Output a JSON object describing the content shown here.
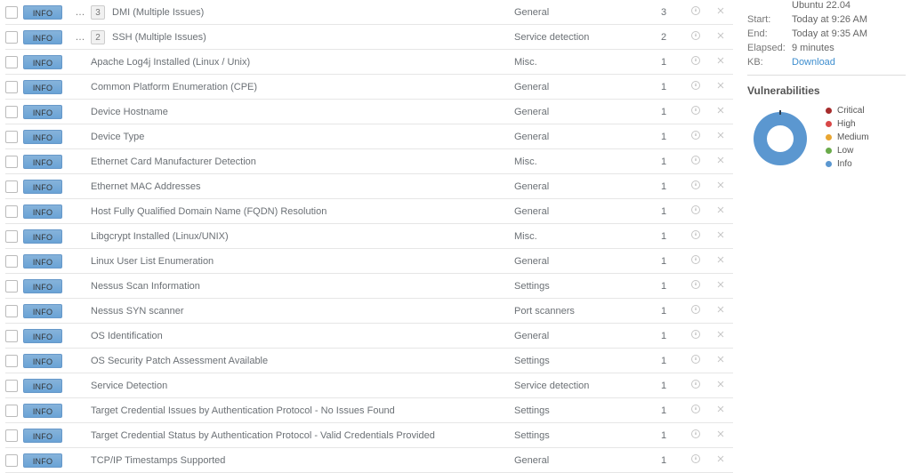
{
  "severity_label": "INFO",
  "rows": [
    {
      "badge": "3",
      "name": "DMI (Multiple Issues)",
      "family": "General",
      "count": "3",
      "multi": true
    },
    {
      "badge": "2",
      "name": "SSH (Multiple Issues)",
      "family": "Service detection",
      "count": "2",
      "multi": true
    },
    {
      "name": "Apache Log4j Installed (Linux / Unix)",
      "family": "Misc.",
      "count": "1"
    },
    {
      "name": "Common Platform Enumeration (CPE)",
      "family": "General",
      "count": "1"
    },
    {
      "name": "Device Hostname",
      "family": "General",
      "count": "1"
    },
    {
      "name": "Device Type",
      "family": "General",
      "count": "1"
    },
    {
      "name": "Ethernet Card Manufacturer Detection",
      "family": "Misc.",
      "count": "1"
    },
    {
      "name": "Ethernet MAC Addresses",
      "family": "General",
      "count": "1"
    },
    {
      "name": "Host Fully Qualified Domain Name (FQDN) Resolution",
      "family": "General",
      "count": "1"
    },
    {
      "name": "Libgcrypt Installed (Linux/UNIX)",
      "family": "Misc.",
      "count": "1"
    },
    {
      "name": "Linux User List Enumeration",
      "family": "General",
      "count": "1"
    },
    {
      "name": "Nessus Scan Information",
      "family": "Settings",
      "count": "1"
    },
    {
      "name": "Nessus SYN scanner",
      "family": "Port scanners",
      "count": "1"
    },
    {
      "name": "OS Identification",
      "family": "General",
      "count": "1"
    },
    {
      "name": "OS Security Patch Assessment Available",
      "family": "Settings",
      "count": "1"
    },
    {
      "name": "Service Detection",
      "family": "Service detection",
      "count": "1"
    },
    {
      "name": "Target Credential Issues by Authentication Protocol - No Issues Found",
      "family": "Settings",
      "count": "1"
    },
    {
      "name": "Target Credential Status by Authentication Protocol - Valid Credentials Provided",
      "family": "Settings",
      "count": "1"
    },
    {
      "name": "TCP/IP Timestamps Supported",
      "family": "General",
      "count": "1"
    }
  ],
  "side": {
    "os": "Ubuntu 22.04",
    "start_label": "Start:",
    "start_value": "Today at 9:26 AM",
    "end_label": "End:",
    "end_value": "Today at 9:35 AM",
    "elapsed_label": "Elapsed:",
    "elapsed_value": "9 minutes",
    "kb_label": "KB:",
    "kb_link": "Download",
    "vuln_title": "Vulnerabilities",
    "legend": [
      {
        "label": "Critical",
        "color": "#a62c2c"
      },
      {
        "label": "High",
        "color": "#d84848"
      },
      {
        "label": "Medium",
        "color": "#e9a632"
      },
      {
        "label": "Low",
        "color": "#6aaa4a"
      },
      {
        "label": "Info",
        "color": "#5b97d0"
      }
    ]
  },
  "chart_data": {
    "type": "pie",
    "title": "Vulnerabilities",
    "series": [
      {
        "name": "Critical",
        "value": 0,
        "color": "#a62c2c"
      },
      {
        "name": "High",
        "value": 0,
        "color": "#d84848"
      },
      {
        "name": "Medium",
        "value": 0,
        "color": "#e9a632"
      },
      {
        "name": "Low",
        "value": 0,
        "color": "#6aaa4a"
      },
      {
        "name": "Info",
        "value": 21,
        "color": "#5b97d0"
      }
    ]
  }
}
